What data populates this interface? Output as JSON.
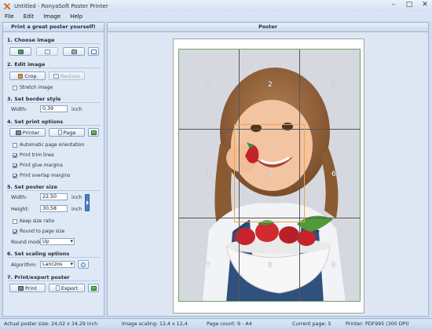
{
  "window": {
    "title": "Untitled - RonyaSoft Poster Printer"
  },
  "menu": [
    "File",
    "Edit",
    "Image",
    "Help"
  ],
  "sidebar": {
    "header": "Print a great poster yourself!",
    "choose_image": {
      "title": "1. Choose image"
    },
    "edit_image": {
      "title": "2. Edit image",
      "crop": "Crop",
      "restore": "Restore",
      "stretch": "Stretch image"
    },
    "border": {
      "title": "3. Set border style",
      "width_label": "Width:",
      "width_value": "0,39",
      "unit": "inch"
    },
    "print_options": {
      "title": "4. Set print options",
      "printer": "Printer",
      "page": "Page",
      "auto_orientation": "Automatic page orientation",
      "trim_lines": "Print trim lines",
      "glue_margins": "Print glue margins",
      "overlap_margins": "Print overlap margins"
    },
    "poster_size": {
      "title": "5. Set poster size",
      "width_label": "Width:",
      "width_value": "22,50",
      "height_label": "Height:",
      "height_value": "30,58",
      "unit": "inch",
      "keep_ratio": "Keep size ratio",
      "round_page": "Round to page size",
      "round_mode_label": "Round mode:",
      "round_mode_value": "Up"
    },
    "scaling": {
      "title": "6. Set scaling options",
      "algorithm_label": "Algorithm:",
      "algorithm_value": "Lanczos"
    },
    "export": {
      "title": "7. Print/export poster",
      "print": "Print",
      "export": "Export"
    }
  },
  "poster": {
    "header": "Poster",
    "pages": [
      "1",
      "2",
      "3",
      "4",
      "5",
      "6",
      "7",
      "8",
      "9"
    ]
  },
  "status": {
    "actual_size": "Actual poster size: 24,02 x 34,29 inch",
    "scaling": "Image scaling: 12,4 x 12,4",
    "page_count": "Page count: 9 - A4",
    "current_page": "Current page: 5",
    "printer": "Printer: PDF995 (300 DPI)"
  },
  "colors": {
    "accent": "#3d74b6",
    "overlap": "#f0a34a",
    "margin_line": "#6da26d"
  }
}
